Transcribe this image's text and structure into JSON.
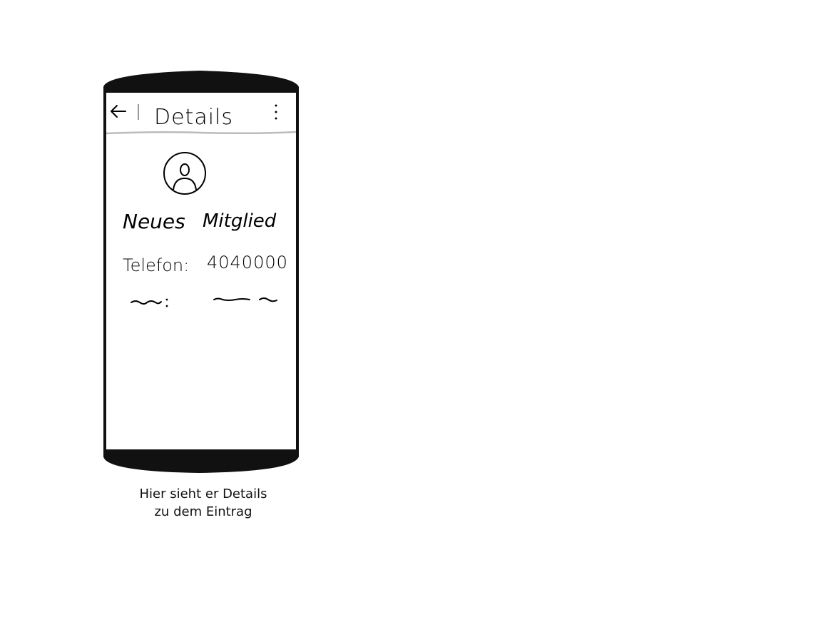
{
  "header": {
    "back_icon": "arrow-left-icon",
    "title": "Details",
    "menu_icon": "more-vertical-icon"
  },
  "profile": {
    "avatar_icon": "user-avatar-icon",
    "name_first": "Neues",
    "name_last": "Mitglied"
  },
  "fields": [
    {
      "label": "Telefon:",
      "value": "4040000"
    }
  ],
  "caption": {
    "line1": "Hier sieht er Details",
    "line2": "zu dem Eintrag"
  },
  "colors": {
    "frame": "#111111",
    "screen": "#ffffff",
    "divider": "#bbbbbb"
  }
}
